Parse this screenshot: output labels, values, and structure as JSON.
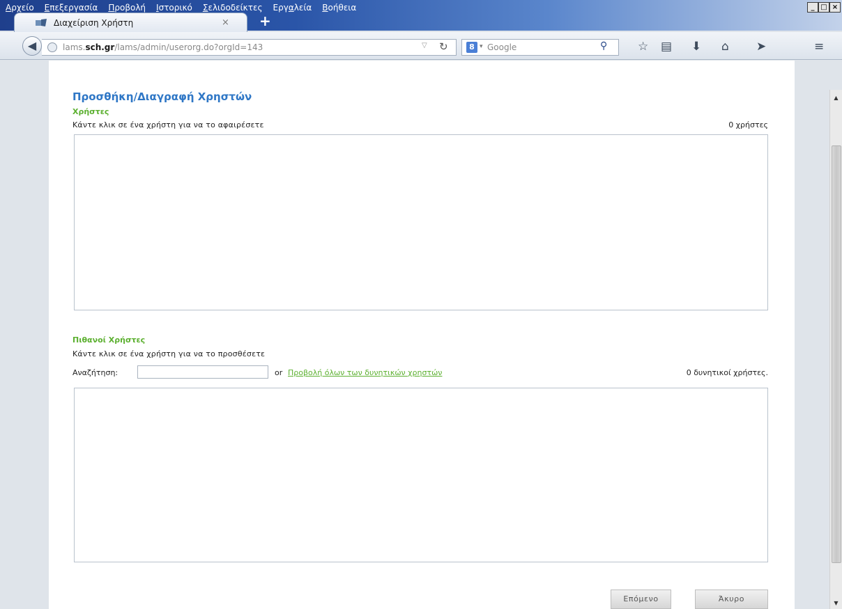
{
  "browser": {
    "menu": [
      {
        "pre": "",
        "key": "Α",
        "post": "ρχείο"
      },
      {
        "pre": "",
        "key": "Ε",
        "post": "πεξεργασία"
      },
      {
        "pre": "",
        "key": "Π",
        "post": "ροβολή"
      },
      {
        "pre": "",
        "key": "Ι",
        "post": "στορικό"
      },
      {
        "pre": "",
        "key": "Σ",
        "post": "ελιδοδείκτες"
      },
      {
        "pre": "Εργ",
        "key": "α",
        "post": "λεία"
      },
      {
        "pre": "",
        "key": "Β",
        "post": "οήθεια"
      }
    ],
    "tab_title": "Διαχείριση Χρήστη",
    "tab_close": "×",
    "new_tab": "+",
    "url_prefix": "lams.",
    "url_host": "sch.gr",
    "url_path": "/lams/admin/userorg.do?orgId=143",
    "search_engine_label": "8",
    "search_placeholder": "Google",
    "window_controls": [
      "_",
      "□",
      "×"
    ]
  },
  "page": {
    "title": "Προσθήκη/Διαγραφή Χρηστών",
    "users_section": {
      "heading": "Χρήστες",
      "hint": "Κάντε κλικ σε ένα χρήστη για να το αφαιρέσετε",
      "count": "0 χρήστες"
    },
    "potential_section": {
      "heading": "Πιθανοί Χρήστες",
      "hint": "Κάντε κλικ σε ένα χρήστη για να το προσθέσετε",
      "search_label": "Αναζήτηση:",
      "search_value": "",
      "or_text": "or",
      "show_all_link": "Προβολή όλων των δυνητικών χρηστών",
      "count": "0 δυνητικοί χρήστες."
    },
    "next_button": "Επόμενο",
    "cancel_button": "Άκυρο"
  }
}
